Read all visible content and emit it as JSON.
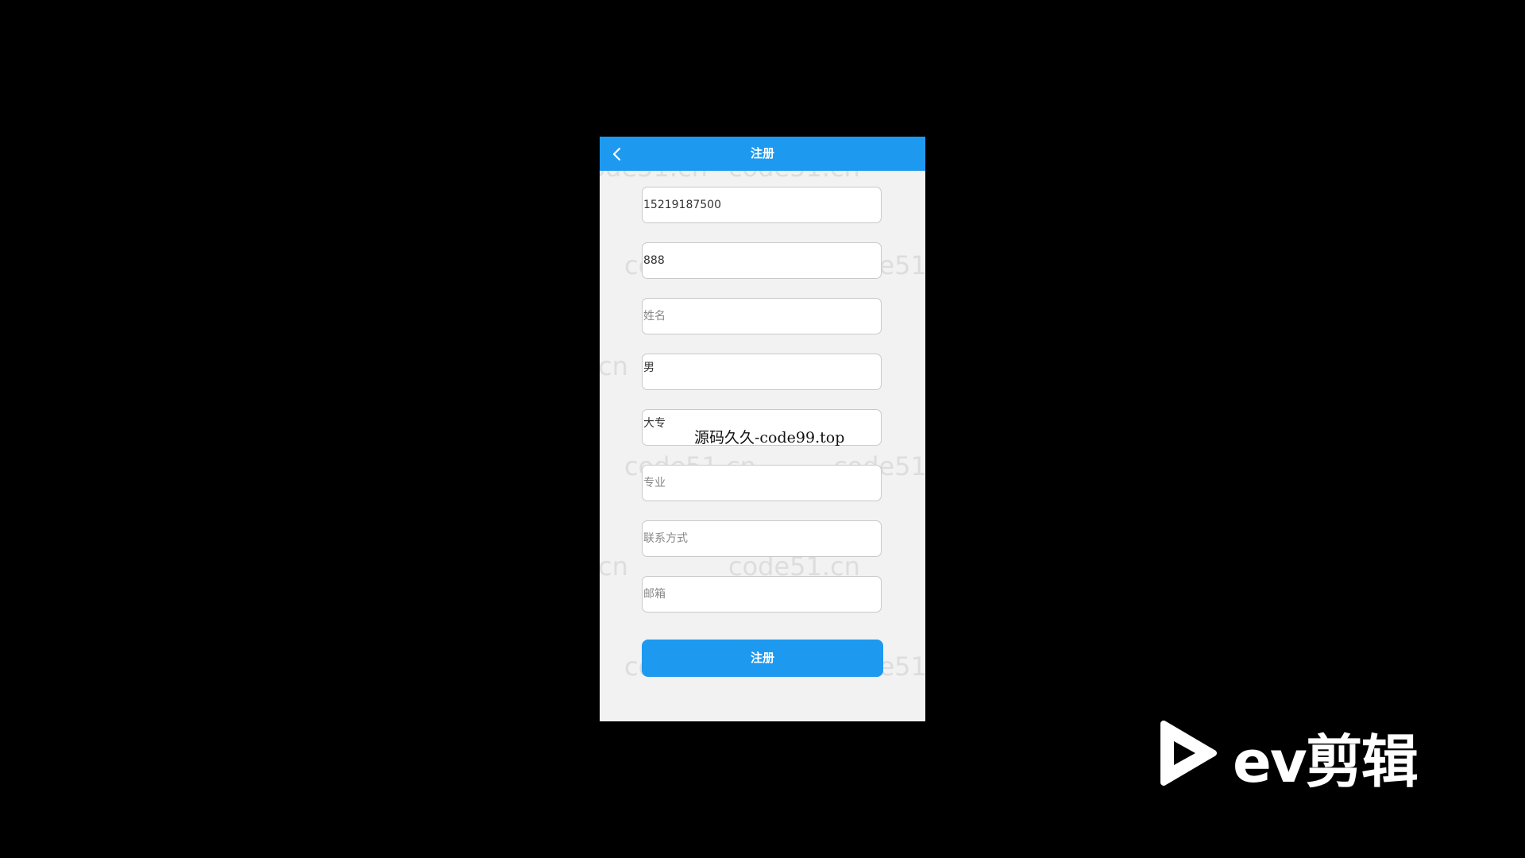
{
  "header": {
    "title": "注册",
    "back_icon": "chevron-left-icon"
  },
  "fields": [
    {
      "name": "phone",
      "value": "15219187500",
      "placeholder": ""
    },
    {
      "name": "password",
      "value": "888",
      "placeholder": ""
    },
    {
      "name": "name",
      "value": "",
      "placeholder": "姓名"
    },
    {
      "name": "gender",
      "value": "男",
      "placeholder": ""
    },
    {
      "name": "education",
      "value": "大专",
      "placeholder": ""
    },
    {
      "name": "major",
      "value": "",
      "placeholder": "专业"
    },
    {
      "name": "contact",
      "value": "",
      "placeholder": "联系方式"
    },
    {
      "name": "email",
      "value": "",
      "placeholder": "邮箱"
    }
  ],
  "submit_label": "注册",
  "watermark_text": "code51.cn",
  "overlay_caption": "源码久久-code99.top",
  "logo_text": "ev剪辑",
  "colors": {
    "accent": "#1e99f0",
    "background": "#000000",
    "panel": "#f2f2f2"
  }
}
